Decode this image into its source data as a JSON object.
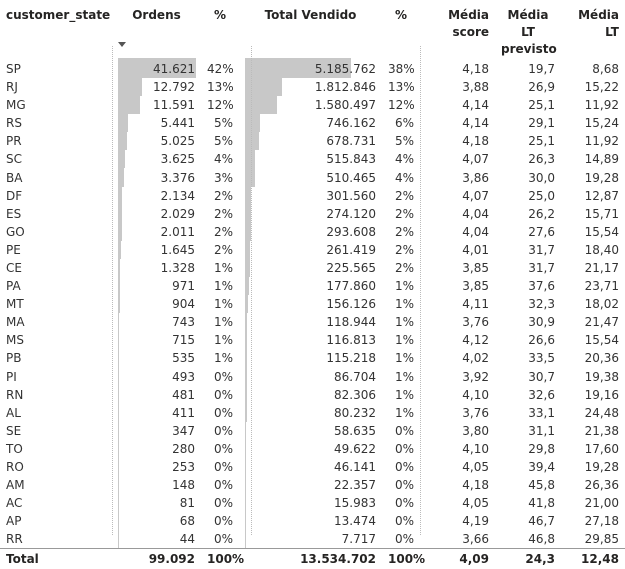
{
  "headers": {
    "state": "customer_state",
    "orders": "Ordens",
    "orders_pct": "%",
    "total_sold": "Total Vendido",
    "total_pct": "%",
    "avg_score_1": "Média",
    "avg_score_2": "score",
    "avg_lt_pred_1": "Média LT",
    "avg_lt_pred_2": "previsto",
    "avg_lt": "Média LT"
  },
  "rows": [
    {
      "state": "SP",
      "orders": "41.621",
      "orders_pct": "42%",
      "total_sold": "5.185.762",
      "total_pct": "38%",
      "avg_score": "4,18",
      "avg_lt_pred": "19,7",
      "avg_lt": "8,68"
    },
    {
      "state": "RJ",
      "orders": "12.792",
      "orders_pct": "13%",
      "total_sold": "1.812.846",
      "total_pct": "13%",
      "avg_score": "3,88",
      "avg_lt_pred": "26,9",
      "avg_lt": "15,22"
    },
    {
      "state": "MG",
      "orders": "11.591",
      "orders_pct": "12%",
      "total_sold": "1.580.497",
      "total_pct": "12%",
      "avg_score": "4,14",
      "avg_lt_pred": "25,1",
      "avg_lt": "11,92"
    },
    {
      "state": "RS",
      "orders": "5.441",
      "orders_pct": "5%",
      "total_sold": "746.162",
      "total_pct": "6%",
      "avg_score": "4,14",
      "avg_lt_pred": "29,1",
      "avg_lt": "15,24"
    },
    {
      "state": "PR",
      "orders": "5.025",
      "orders_pct": "5%",
      "total_sold": "678.731",
      "total_pct": "5%",
      "avg_score": "4,18",
      "avg_lt_pred": "25,1",
      "avg_lt": "11,92"
    },
    {
      "state": "SC",
      "orders": "3.625",
      "orders_pct": "4%",
      "total_sold": "515.843",
      "total_pct": "4%",
      "avg_score": "4,07",
      "avg_lt_pred": "26,3",
      "avg_lt": "14,89"
    },
    {
      "state": "BA",
      "orders": "3.376",
      "orders_pct": "3%",
      "total_sold": "510.465",
      "total_pct": "4%",
      "avg_score": "3,86",
      "avg_lt_pred": "30,0",
      "avg_lt": "19,28"
    },
    {
      "state": "DF",
      "orders": "2.134",
      "orders_pct": "2%",
      "total_sold": "301.560",
      "total_pct": "2%",
      "avg_score": "4,07",
      "avg_lt_pred": "25,0",
      "avg_lt": "12,87"
    },
    {
      "state": "ES",
      "orders": "2.029",
      "orders_pct": "2%",
      "total_sold": "274.120",
      "total_pct": "2%",
      "avg_score": "4,04",
      "avg_lt_pred": "26,2",
      "avg_lt": "15,71"
    },
    {
      "state": "GO",
      "orders": "2.011",
      "orders_pct": "2%",
      "total_sold": "293.608",
      "total_pct": "2%",
      "avg_score": "4,04",
      "avg_lt_pred": "27,6",
      "avg_lt": "15,54"
    },
    {
      "state": "PE",
      "orders": "1.645",
      "orders_pct": "2%",
      "total_sold": "261.419",
      "total_pct": "2%",
      "avg_score": "4,01",
      "avg_lt_pred": "31,7",
      "avg_lt": "18,40"
    },
    {
      "state": "CE",
      "orders": "1.328",
      "orders_pct": "1%",
      "total_sold": "225.565",
      "total_pct": "2%",
      "avg_score": "3,85",
      "avg_lt_pred": "31,7",
      "avg_lt": "21,17"
    },
    {
      "state": "PA",
      "orders": "971",
      "orders_pct": "1%",
      "total_sold": "177.860",
      "total_pct": "1%",
      "avg_score": "3,85",
      "avg_lt_pred": "37,6",
      "avg_lt": "23,71"
    },
    {
      "state": "MT",
      "orders": "904",
      "orders_pct": "1%",
      "total_sold": "156.126",
      "total_pct": "1%",
      "avg_score": "4,11",
      "avg_lt_pred": "32,3",
      "avg_lt": "18,02"
    },
    {
      "state": "MA",
      "orders": "743",
      "orders_pct": "1%",
      "total_sold": "118.944",
      "total_pct": "1%",
      "avg_score": "3,76",
      "avg_lt_pred": "30,9",
      "avg_lt": "21,47"
    },
    {
      "state": "MS",
      "orders": "715",
      "orders_pct": "1%",
      "total_sold": "116.813",
      "total_pct": "1%",
      "avg_score": "4,12",
      "avg_lt_pred": "26,6",
      "avg_lt": "15,54"
    },
    {
      "state": "PB",
      "orders": "535",
      "orders_pct": "1%",
      "total_sold": "115.218",
      "total_pct": "1%",
      "avg_score": "4,02",
      "avg_lt_pred": "33,5",
      "avg_lt": "20,36"
    },
    {
      "state": "PI",
      "orders": "493",
      "orders_pct": "0%",
      "total_sold": "86.704",
      "total_pct": "1%",
      "avg_score": "3,92",
      "avg_lt_pred": "30,7",
      "avg_lt": "19,38"
    },
    {
      "state": "RN",
      "orders": "481",
      "orders_pct": "0%",
      "total_sold": "82.306",
      "total_pct": "1%",
      "avg_score": "4,10",
      "avg_lt_pred": "32,6",
      "avg_lt": "19,16"
    },
    {
      "state": "AL",
      "orders": "411",
      "orders_pct": "0%",
      "total_sold": "80.232",
      "total_pct": "1%",
      "avg_score": "3,76",
      "avg_lt_pred": "33,1",
      "avg_lt": "24,48"
    },
    {
      "state": "SE",
      "orders": "347",
      "orders_pct": "0%",
      "total_sold": "58.635",
      "total_pct": "0%",
      "avg_score": "3,80",
      "avg_lt_pred": "31,1",
      "avg_lt": "21,38"
    },
    {
      "state": "TO",
      "orders": "280",
      "orders_pct": "0%",
      "total_sold": "49.622",
      "total_pct": "0%",
      "avg_score": "4,10",
      "avg_lt_pred": "29,8",
      "avg_lt": "17,60"
    },
    {
      "state": "RO",
      "orders": "253",
      "orders_pct": "0%",
      "total_sold": "46.141",
      "total_pct": "0%",
      "avg_score": "4,05",
      "avg_lt_pred": "39,4",
      "avg_lt": "19,28"
    },
    {
      "state": "AM",
      "orders": "148",
      "orders_pct": "0%",
      "total_sold": "22.357",
      "total_pct": "0%",
      "avg_score": "4,18",
      "avg_lt_pred": "45,8",
      "avg_lt": "26,36"
    },
    {
      "state": "AC",
      "orders": "81",
      "orders_pct": "0%",
      "total_sold": "15.983",
      "total_pct": "0%",
      "avg_score": "4,05",
      "avg_lt_pred": "41,8",
      "avg_lt": "21,00"
    },
    {
      "state": "AP",
      "orders": "68",
      "orders_pct": "0%",
      "total_sold": "13.474",
      "total_pct": "0%",
      "avg_score": "4,19",
      "avg_lt_pred": "46,7",
      "avg_lt": "27,18"
    },
    {
      "state": "RR",
      "orders": "44",
      "orders_pct": "0%",
      "total_sold": "7.717",
      "total_pct": "0%",
      "avg_score": "3,66",
      "avg_lt_pred": "46,8",
      "avg_lt": "29,85"
    }
  ],
  "total": {
    "label": "Total",
    "orders": "99.092",
    "orders_pct": "100%",
    "total_sold": "13.534.702",
    "total_pct": "100%",
    "avg_score": "4,09",
    "avg_lt_pred": "24,3",
    "avg_lt": "12,48"
  },
  "bar_fraction_orders": [
    1.0,
    0.307,
    0.278,
    0.131,
    0.121,
    0.087,
    0.081,
    0.051,
    0.049,
    0.048,
    0.04,
    0.032,
    0.023,
    0.022,
    0.018,
    0.017,
    0.013,
    0.012,
    0.012,
    0.01,
    0.008,
    0.007,
    0.006,
    0.004,
    0.002,
    0.002,
    0.001
  ],
  "bar_fraction_sold": [
    1.0,
    0.35,
    0.305,
    0.144,
    0.131,
    0.099,
    0.098,
    0.058,
    0.053,
    0.057,
    0.05,
    0.043,
    0.034,
    0.03,
    0.023,
    0.023,
    0.022,
    0.017,
    0.016,
    0.015,
    0.011,
    0.01,
    0.009,
    0.004,
    0.003,
    0.003,
    0.001
  ],
  "colors": {
    "bar": "#c8c8c8",
    "text": "#333333",
    "header": "#252423"
  }
}
